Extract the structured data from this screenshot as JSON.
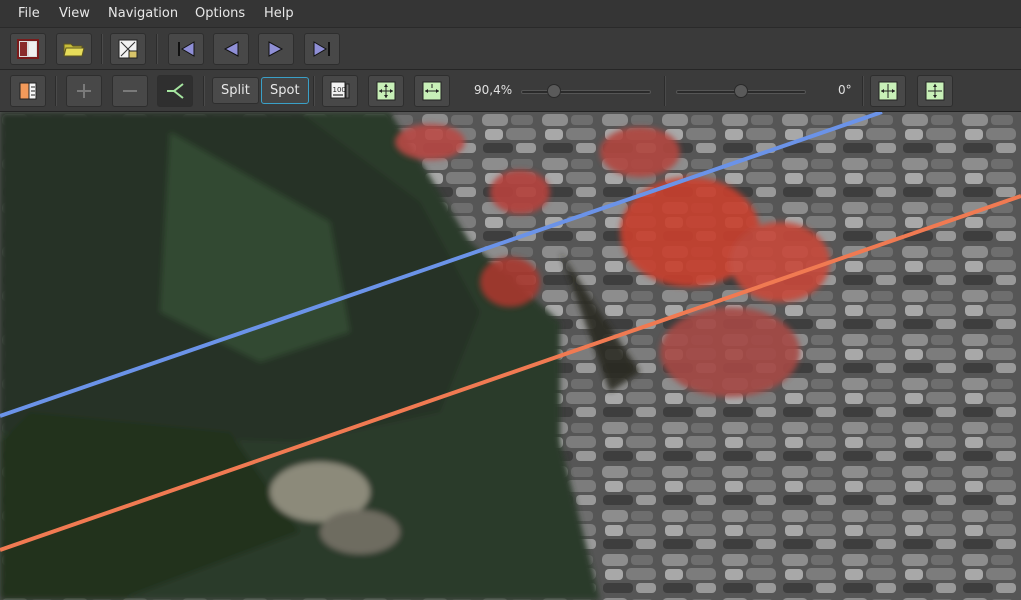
{
  "menu": {
    "file": "File",
    "view": "View",
    "navigation": "Navigation",
    "options": "Options",
    "help": "Help"
  },
  "toolbar": {
    "split_label": "Split",
    "spot_label": "Spot",
    "zoom_value": "90,4%",
    "zoom_level": 0.22,
    "rotation_value": "0°",
    "rotation_level": 0.5
  },
  "colors": {
    "split_line_blue": "#6b93e8",
    "split_line_orange": "#f07a52",
    "active_border": "#3aa0c8"
  },
  "icons": {
    "toolbar1": [
      "panel-icon",
      "open-folder-icon",
      "fit-image-icon",
      "first-icon",
      "previous-icon",
      "next-icon",
      "last-icon"
    ],
    "toolbar2": [
      "color-panel-icon",
      "plus-icon",
      "minus-icon",
      "split-angle-icon",
      "zoom-100-icon",
      "fit-window-icon",
      "fit-width-icon",
      "flip-horizontal-icon",
      "flip-vertical-icon"
    ]
  }
}
